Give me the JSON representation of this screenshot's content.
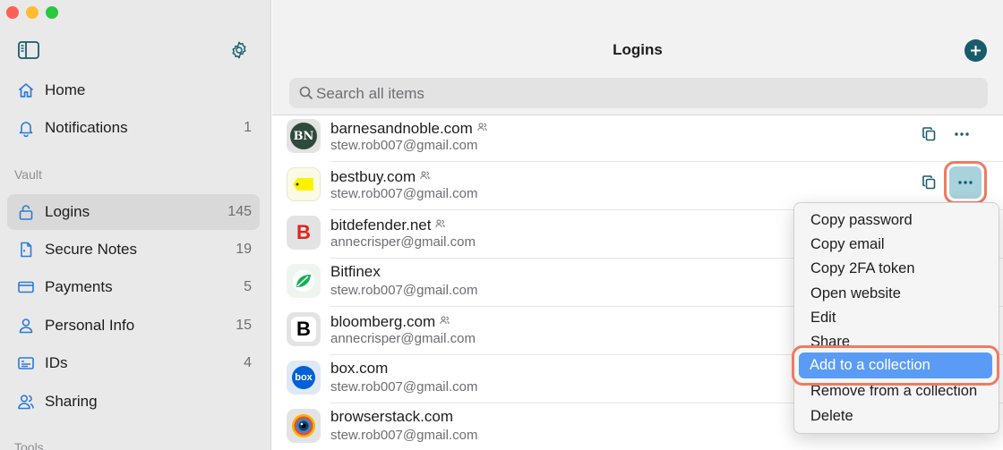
{
  "sidebar": {
    "items": [
      {
        "label": "Home",
        "count": ""
      },
      {
        "label": "Notifications",
        "count": "1"
      }
    ],
    "vault_label": "Vault",
    "vault_items": [
      {
        "label": "Logins",
        "count": "145"
      },
      {
        "label": "Secure Notes",
        "count": "19"
      },
      {
        "label": "Payments",
        "count": "5"
      },
      {
        "label": "Personal Info",
        "count": "15"
      },
      {
        "label": "IDs",
        "count": "4"
      },
      {
        "label": "Sharing",
        "count": ""
      }
    ],
    "tools_label": "Tools"
  },
  "header": {
    "title": "Logins",
    "search_placeholder": "Search all items"
  },
  "logins": [
    {
      "name": "barnesandnoble.com",
      "email": "stew.rob007@gmail.com",
      "shared": true,
      "logo_text": "BN"
    },
    {
      "name": "bestbuy.com",
      "email": "stew.rob007@gmail.com",
      "shared": true,
      "logo_text": ""
    },
    {
      "name": "bitdefender.net",
      "email": "annecrisper@gmail.com",
      "shared": true,
      "logo_text": "B"
    },
    {
      "name": "Bitfinex",
      "email": "stew.rob007@gmail.com",
      "shared": false,
      "logo_text": ""
    },
    {
      "name": "bloomberg.com",
      "email": "annecrisper@gmail.com",
      "shared": true,
      "logo_text": "B"
    },
    {
      "name": "box.com",
      "email": "stew.rob007@gmail.com",
      "shared": false,
      "logo_text": "box"
    },
    {
      "name": "browserstack.com",
      "email": "stew.rob007@gmail.com",
      "shared": false,
      "logo_text": ""
    }
  ],
  "context_menu": {
    "items": [
      "Copy password",
      "Copy email",
      "Copy 2FA token",
      "Open website",
      "Edit",
      "Share",
      "Add to a collection",
      "Remove from a collection",
      "Delete"
    ],
    "highlighted": "Add to a collection"
  },
  "colors": {
    "accent": "#185c6b",
    "highlight_ring": "#ee7b62",
    "menu_selection": "#5a9cf5",
    "sidebar_bg": "#e9e9e9"
  }
}
